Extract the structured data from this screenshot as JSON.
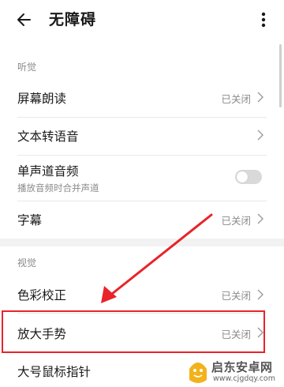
{
  "header": {
    "title": "无障碍",
    "back_icon": "arrow-left-icon",
    "more_icon": "more-vertical-icon"
  },
  "hearing": {
    "section_title": "听觉",
    "items": [
      {
        "label": "屏幕朗读",
        "value": "已关闭"
      },
      {
        "label": "文本转语音",
        "value": ""
      },
      {
        "label": "单声道音频",
        "subtitle": "播放音频时合并声道",
        "toggle_on": false
      },
      {
        "label": "字幕",
        "value": "已关闭"
      }
    ]
  },
  "vision": {
    "section_title": "视觉",
    "items": [
      {
        "label": "色彩校正",
        "value": "已关闭"
      },
      {
        "label": "放大手势",
        "value": "已关闭"
      },
      {
        "label": "大号鼠标指针",
        "value": ""
      }
    ]
  },
  "annotation": {
    "highlight_color": "#e8232a",
    "arrow_color": "#e8232a"
  },
  "watermark": {
    "name_cn": "启东安卓网",
    "url": "www.cjgdqy.com"
  }
}
